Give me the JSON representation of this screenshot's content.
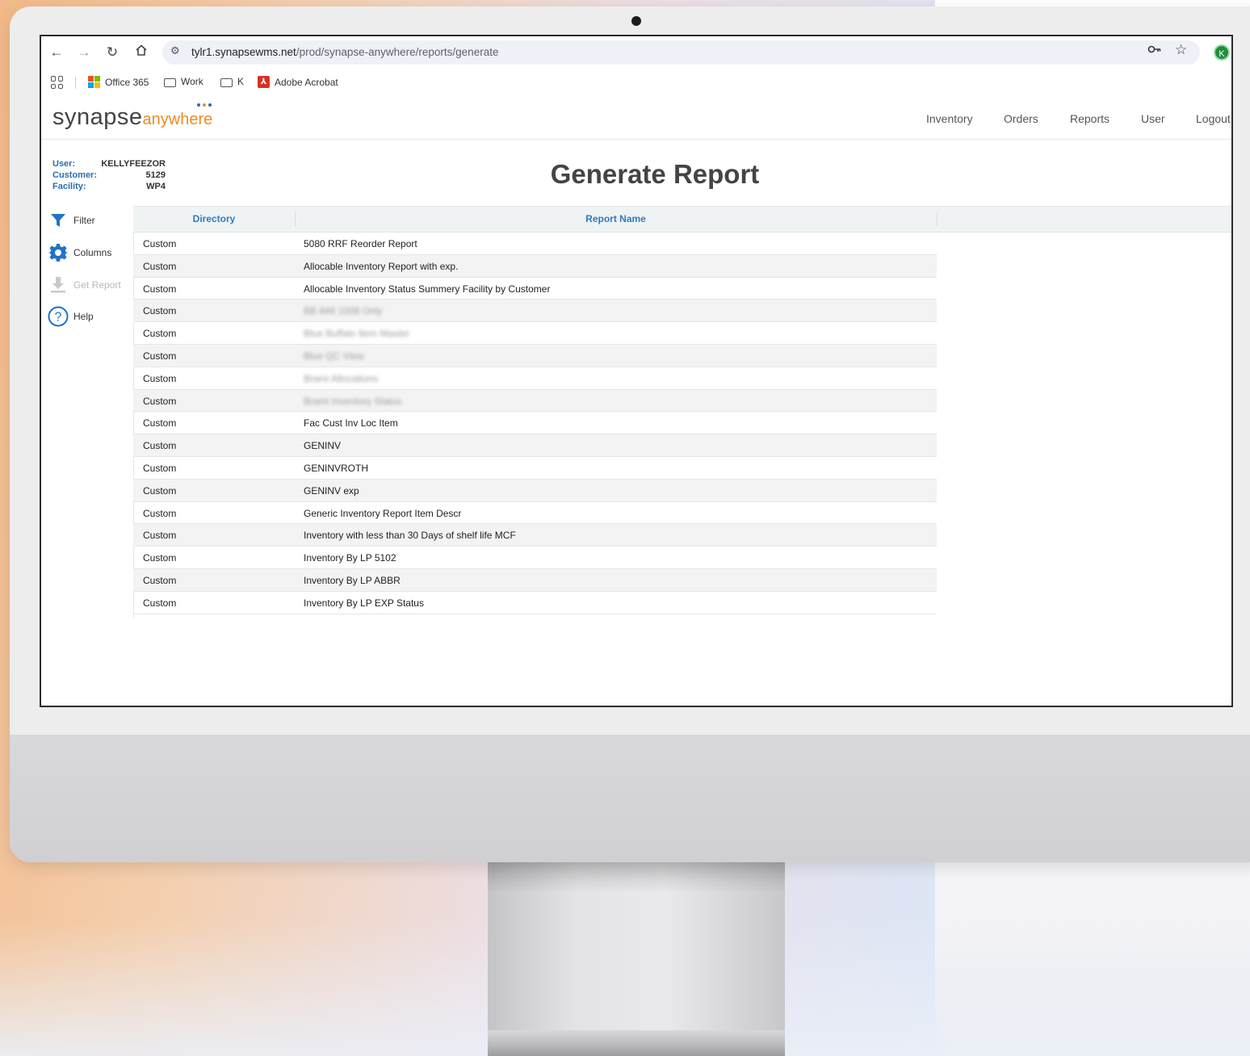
{
  "browser": {
    "url_host": "tylr1.synapsewms.net",
    "url_path": "/prod/synapse-anywhere/reports/generate",
    "profile_initial": "K",
    "bookmarks": [
      {
        "label": "Office 365"
      },
      {
        "label": "Work"
      },
      {
        "label": "K"
      },
      {
        "label": "Adobe Acrobat"
      }
    ]
  },
  "app": {
    "logo_main": "synapse",
    "logo_sub": "anywhere",
    "nav": [
      "Inventory",
      "Orders",
      "Reports",
      "User",
      "Logout"
    ],
    "user_info": {
      "user_label": "User:",
      "user_value": "KELLYFEEZOR",
      "customer_label": "Customer:",
      "customer_value": "5129",
      "facility_label": "Facility:",
      "facility_value": "WP4"
    },
    "page_title": "Generate Report",
    "tools": [
      {
        "label": "Filter",
        "enabled": true,
        "icon": "filter-icon"
      },
      {
        "label": "Columns",
        "enabled": true,
        "icon": "gear-icon"
      },
      {
        "label": "Get Report",
        "enabled": false,
        "icon": "download-icon"
      },
      {
        "label": "Help",
        "enabled": true,
        "icon": "help-icon"
      }
    ],
    "table": {
      "headers": [
        "Directory",
        "Report Name"
      ],
      "rows": [
        {
          "directory": "Custom",
          "name": "5080 RRF Reorder Report",
          "blurred": false
        },
        {
          "directory": "Custom",
          "name": "Allocable Inventory Report with exp.",
          "blurred": false
        },
        {
          "directory": "Custom",
          "name": "Allocable Inventory Status Summery Facility by Customer",
          "blurred": false
        },
        {
          "directory": "Custom",
          "name": "BB 846 1008 Only",
          "blurred": true
        },
        {
          "directory": "Custom",
          "name": "Blue Buffalo Item Master",
          "blurred": true
        },
        {
          "directory": "Custom",
          "name": "Blue QC View",
          "blurred": true
        },
        {
          "directory": "Custom",
          "name": "Brami Allocations",
          "blurred": true
        },
        {
          "directory": "Custom",
          "name": "Brami Inventory Status",
          "blurred": true
        },
        {
          "directory": "Custom",
          "name": "Fac Cust Inv Loc Item",
          "blurred": false
        },
        {
          "directory": "Custom",
          "name": "GENINV",
          "blurred": false
        },
        {
          "directory": "Custom",
          "name": "GENINVROTH",
          "blurred": false
        },
        {
          "directory": "Custom",
          "name": "GENINV exp",
          "blurred": false
        },
        {
          "directory": "Custom",
          "name": "Generic Inventory Report Item Descr",
          "blurred": false
        },
        {
          "directory": "Custom",
          "name": "Inventory with less than 30 Days of shelf life MCF",
          "blurred": false
        },
        {
          "directory": "Custom",
          "name": "Inventory By LP 5102",
          "blurred": false
        },
        {
          "directory": "Custom",
          "name": "Inventory By LP ABBR",
          "blurred": false
        },
        {
          "directory": "Custom",
          "name": "Inventory By LP EXP Status",
          "blurred": false
        }
      ]
    }
  },
  "colors": {
    "accent_blue": "#2f7bc0",
    "logo_orange": "#f08a24",
    "tool_blue": "#1f73c8"
  }
}
